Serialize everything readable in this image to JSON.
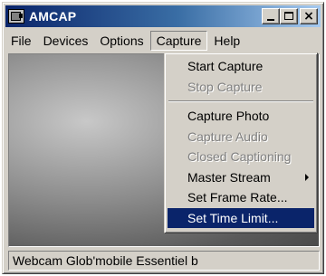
{
  "window": {
    "title": "AMCAP",
    "buttons": {
      "minimize": "minimize",
      "maximize": "maximize",
      "close": "×"
    }
  },
  "menubar": {
    "items": [
      "File",
      "Devices",
      "Options",
      "Capture",
      "Help"
    ],
    "active": "Capture"
  },
  "capture_menu": {
    "group1": [
      {
        "label": "Start Capture",
        "enabled": true
      },
      {
        "label": "Stop Capture",
        "enabled": false
      }
    ],
    "group2": [
      {
        "label": "Capture Photo",
        "enabled": true
      },
      {
        "label": "Capture Audio",
        "enabled": false
      },
      {
        "label": "Closed Captioning",
        "enabled": false
      },
      {
        "label": "Master Stream",
        "enabled": true,
        "submenu": true
      },
      {
        "label": "Set Frame Rate...",
        "enabled": true
      },
      {
        "label": "Set Time Limit...",
        "enabled": true,
        "highlighted": true
      }
    ]
  },
  "statusbar": {
    "text": "Webcam Glob'mobile Essentiel b"
  },
  "colors": {
    "titlebar_start": "#0a246a",
    "titlebar_end": "#a6caf0",
    "face": "#d4d0c8",
    "highlight": "#0a246a",
    "disabled_text": "#808080"
  }
}
